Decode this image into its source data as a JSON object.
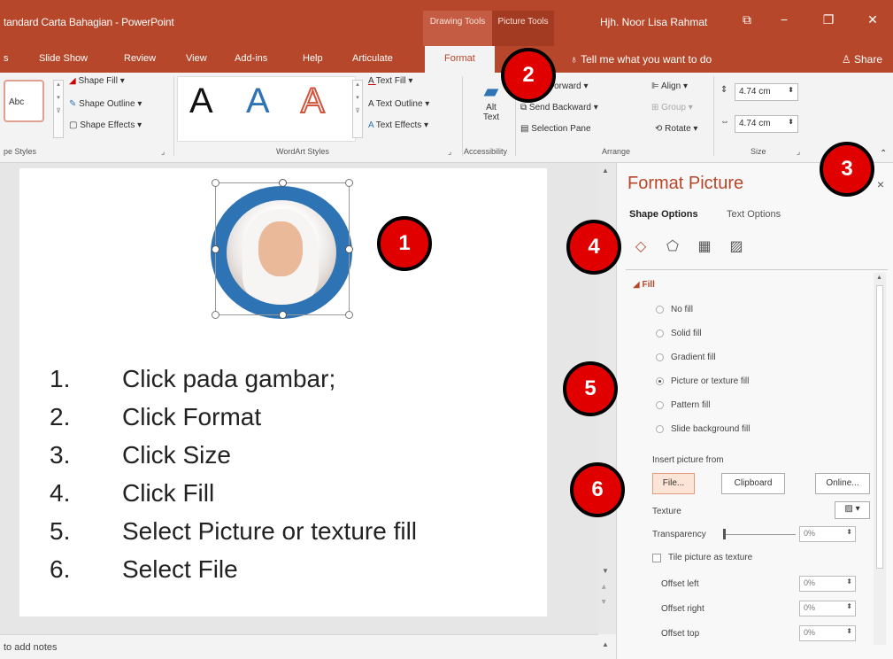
{
  "titlebar": {
    "doc_title": "tandard Carta Bahagian  -  PowerPoint",
    "ctx_drawing": "Drawing Tools",
    "ctx_picture": "Picture Tools",
    "user": "Hjh. Noor Lisa Rahmat",
    "restore": "⧉",
    "minimize": "−",
    "maximize": "❐",
    "close": "✕"
  },
  "tabs": {
    "s": "s",
    "slide_show": "Slide Show",
    "review": "Review",
    "view": "View",
    "addins": "Add-ins",
    "help": "Help",
    "articulate": "Articulate",
    "format": "Format",
    "tellme": "Tell me what you want to do",
    "share": "Share"
  },
  "ribbon": {
    "abc": "Abc",
    "shape_fill": "Shape Fill ▾",
    "shape_outline": "Shape Outline ▾",
    "shape_effects": "Shape Effects ▾",
    "shape_styles": "pe Styles",
    "wordart_a": "A",
    "text_fill": "Text Fill ▾",
    "text_outline": "Text Outline ▾",
    "text_effects": "Text Effects ▾",
    "wordart_styles": "WordArt Styles",
    "alt_text_1": "Alt",
    "alt_text_2": "Text",
    "accessibility": "Accessibility",
    "forward": "Forward  ▾",
    "send_backward": "Send Backward  ▾",
    "selection_pane": "Selection Pane",
    "align": "Align ▾",
    "group": "Group ▾",
    "rotate": "Rotate ▾",
    "arrange": "Arrange",
    "height": "4.74 cm",
    "width": "4.74 cm",
    "size": "Size"
  },
  "steps": [
    {
      "num": "1.",
      "text": "Click pada gambar;"
    },
    {
      "num": "2.",
      "text": "Click Format"
    },
    {
      "num": "3.",
      "text": "Click Size"
    },
    {
      "num": "4.",
      "text": "Click Fill"
    },
    {
      "num": "5.",
      "text": "Select Picture or texture fill"
    },
    {
      "num": "6.",
      "text": "Select File"
    }
  ],
  "notes": "to add notes",
  "pane": {
    "title": "Format Picture",
    "close": "×",
    "shape_options": "Shape Options",
    "text_options": "Text Options",
    "fill_section": "◢  Fill",
    "fills": [
      "No fill",
      "Solid fill",
      "Gradient fill",
      "Picture or texture fill",
      "Pattern fill",
      "Slide background fill"
    ],
    "insert_from": "Insert picture from",
    "file_btn": "File...",
    "clipboard_btn": "Clipboard",
    "online_btn": "Online...",
    "texture": "Texture",
    "transparency": "Transparency",
    "tile": "Tile picture as texture",
    "offset_left": "Offset left",
    "offset_right": "Offset right",
    "offset_top": "Offset top",
    "pct": "0%"
  },
  "callouts": [
    "1",
    "2",
    "3",
    "4",
    "5",
    "6"
  ],
  "colors": {
    "accent": "#b7472a",
    "callout": "#e00000",
    "photo_ring": "#2e74b5"
  }
}
